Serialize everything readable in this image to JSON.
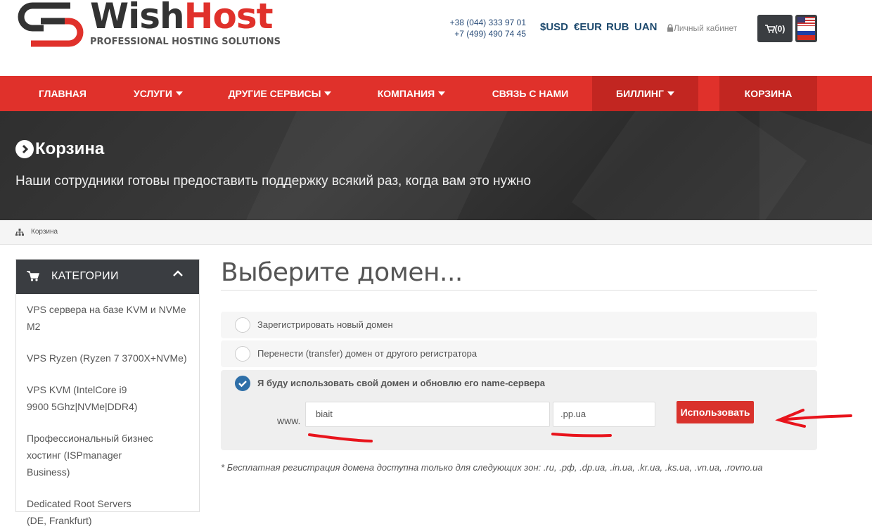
{
  "header": {
    "logo_text_a": "Wish",
    "logo_text_b": "Host",
    "logo_sub": "PROFESSIONAL HOSTING SOLUTIONS",
    "phones": [
      "+38 (044) 333 97 01",
      "+7 (499) 490 74 45"
    ],
    "currencies": [
      "$USD",
      "€EUR",
      "RUB",
      "UAN"
    ],
    "cabinet": "Личный кабинет",
    "cart_count": "(0)",
    "brand_color": "#e0312b"
  },
  "nav": {
    "items": [
      {
        "label": "ГЛАВНАЯ",
        "dropdown": false
      },
      {
        "label": "УСЛУГИ",
        "dropdown": true
      },
      {
        "label": "ДРУГИЕ СЕРВИСЫ",
        "dropdown": true
      },
      {
        "label": "КОМПАНИЯ",
        "dropdown": true
      },
      {
        "label": "СВЯЗЬ С НАМИ",
        "dropdown": false
      },
      {
        "label": "БИЛЛИНГ",
        "dropdown": true
      },
      {
        "label": "КОРЗИНА",
        "dropdown": false
      }
    ]
  },
  "hero": {
    "title": "Корзина",
    "subtitle": "Наши сотрудники готовы предоставить поддержку всякий раз, когда вам это нужно"
  },
  "breadcrumb": {
    "current": "Корзина"
  },
  "sidebar": {
    "title": "КАТЕГОРИИ",
    "items": [
      "VPS сервера на базе KVM и NVMe M2",
      "VPS Ryzen (Ryzen 7 3700X+NVMe)",
      "VPS KVM (IntelCore i9 9900 5Ghz|NVMe|DDR4)",
      "Профессиональный бизнес хостинг (ISPmanager Business)",
      "Dedicated Root Servers (DE, Frankfurt)"
    ]
  },
  "main": {
    "title": "Выберите домен...",
    "options": [
      {
        "label": "Зарегистрировать новый домен",
        "checked": false
      },
      {
        "label": "Перенести (transfer) домен от другого регистратора",
        "checked": false
      },
      {
        "label": "Я буду использовать свой домен и обновлю его name-сервера",
        "checked": true
      }
    ],
    "www_label": "www.",
    "domain_value": "biait",
    "tld_value": ".pp.ua",
    "use_button": "Использовать",
    "note": "* Бесплатная регистрация домена доступна только для следующих зон: .ru, .рф, .dp.ua, .in.ua, .kr.ua, .ks.ua, .vn.ua, .rovno.ua"
  }
}
